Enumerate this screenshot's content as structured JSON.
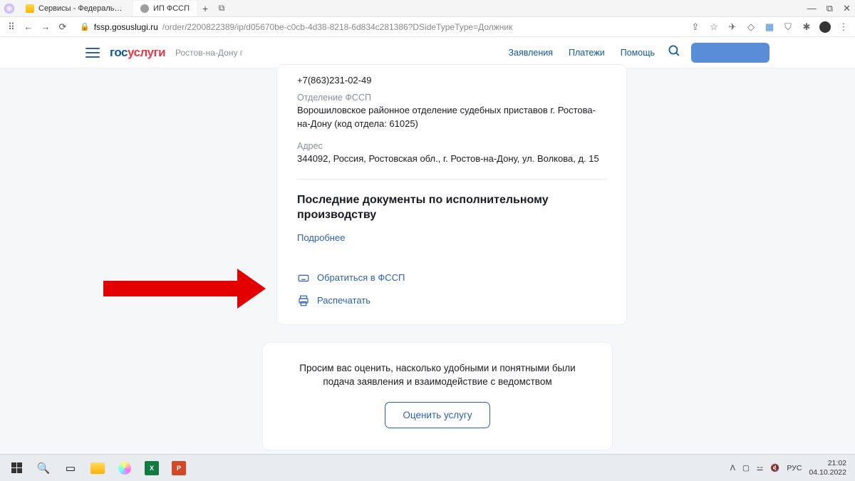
{
  "browser": {
    "tabs": [
      {
        "title": "Сервисы - Федеральная слу"
      },
      {
        "title": "ИП ФССП"
      }
    ],
    "url_host": "fssp.gosuslugi.ru",
    "url_path": "/order/2200822389/ip/d05670be-c0cb-4d38-8218-6d834c281386?DSideTypeType=Должник"
  },
  "header": {
    "logo_blue": "гос",
    "logo_red": "услуги",
    "city": "Ростов-на-Дону г",
    "nav": {
      "applications": "Заявления",
      "payments": "Платежи",
      "help": "Помощь"
    }
  },
  "card": {
    "phone": "+7(863)231-02-49",
    "dept_label": "Отделение ФССП",
    "dept_value": "Ворошиловское районное отделение судебных приставов г. Ростова-на-Дону (код отдела: 61025)",
    "addr_label": "Адрес",
    "addr_value": "344092, Россия, Ростовская обл., г. Ростов-на-Дону, ул. Волкова, д. 15",
    "section_title": "Последние документы по исполнительному производству",
    "more_link": "Подробнее",
    "contact_link": "Обратиться в ФССП",
    "print_link": "Распечатать"
  },
  "feedback": {
    "text": "Просим вас оценить, насколько удобными и понятными были подача заявления и взаимодействие с ведомством",
    "button": "Оценить услугу"
  },
  "taskbar": {
    "lang": "РУС",
    "time": "21:02",
    "date": "04.10.2022"
  }
}
